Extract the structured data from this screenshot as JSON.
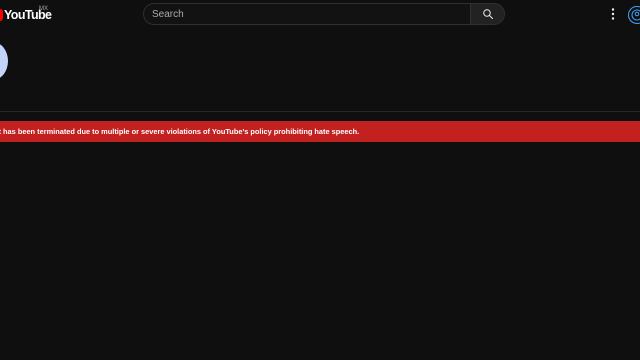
{
  "header": {
    "logo_text": "YouTube",
    "country_code": "MX",
    "search": {
      "placeholder": "Search",
      "value": ""
    },
    "icons": {
      "search": "search-icon",
      "more": "more-vert-icon",
      "account": "account-circle-icon"
    }
  },
  "alert": {
    "message": "ot has been terminated due to multiple or severe violations of YouTube's policy prohibiting hate speech."
  },
  "colors": {
    "background": "#0f0f0f",
    "brand_red": "#ff0000",
    "alert_red": "#c32020",
    "link_blue": "#3ea6ff",
    "avatar": "#c2d4f7"
  }
}
